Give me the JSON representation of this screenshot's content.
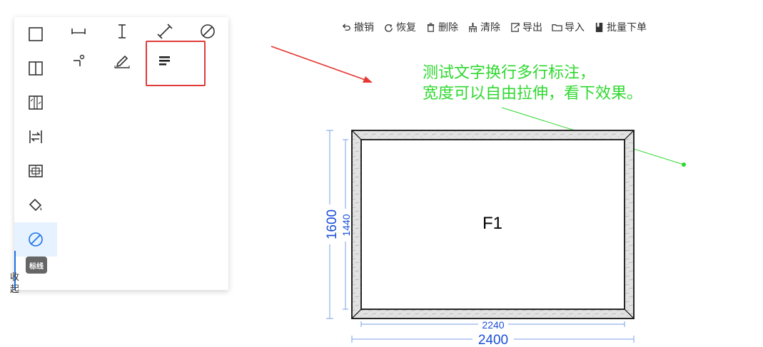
{
  "toolbar": {
    "undo": "撤销",
    "redo": "恢复",
    "delete": "删除",
    "clear": "清除",
    "export": "导出",
    "import": "导入",
    "batch_order": "批量下单"
  },
  "side_tools": [
    "rectangle-tool",
    "split-tool",
    "mullion-tool",
    "swap-tool",
    "grid-tool",
    "paint-tool",
    "dimension-tool"
  ],
  "side_tag_label": "标线",
  "collapse_label": "收起",
  "annotation_text": "测试文字换行多行标注，\n宽度可以自由拉伸，看下效果。",
  "drawing": {
    "window_label": "F1",
    "outer_width": "2400",
    "inner_width": "2240",
    "outer_height": "1600",
    "inner_height": "1440"
  },
  "colors": {
    "accent": "#1a73e8",
    "highlight": "#e03b3b",
    "annotation": "#2fd82f",
    "dimension": "#1a4fd6"
  }
}
